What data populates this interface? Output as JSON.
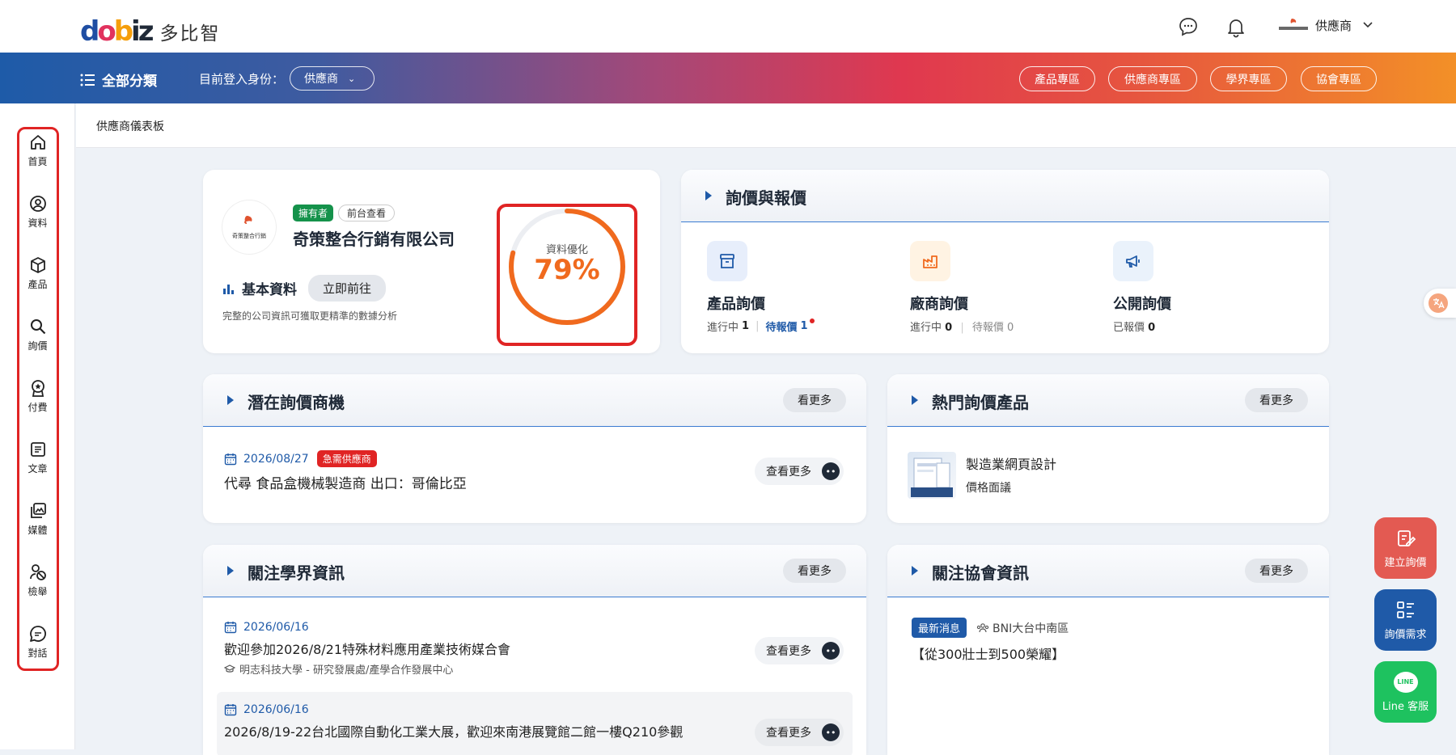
{
  "brand": {
    "logo": "dobiz",
    "name": "多比智",
    "accent": "#1f5aa8",
    "alert": "#e02424",
    "orange": "#f06a1e"
  },
  "top": {
    "chat_icon": "chat-bubble-icon",
    "bell_icon": "bell-icon",
    "user_role": "供應商"
  },
  "band": {
    "all_categories": "全部分類",
    "login_as": "目前登入身份：",
    "role": "供應商",
    "pills": [
      "產品專區",
      "供應商專區",
      "學界專區",
      "協會專區"
    ]
  },
  "sidebar": [
    {
      "label": "首頁",
      "icon": "home-icon"
    },
    {
      "label": "資料",
      "icon": "user-circle-icon"
    },
    {
      "label": "產品",
      "icon": "box-icon"
    },
    {
      "label": "詢價",
      "icon": "search-icon"
    },
    {
      "label": "付費",
      "icon": "award-icon"
    },
    {
      "label": "文章",
      "icon": "document-icon"
    },
    {
      "label": "媒體",
      "icon": "media-icon"
    },
    {
      "label": "檢舉",
      "icon": "report-icon"
    },
    {
      "label": "對話",
      "icon": "chat-icon"
    }
  ],
  "breadcrumb": "供應商儀表板",
  "company": {
    "badge_owner": "擁有者",
    "badge_front": "前台查看",
    "name": "奇策整合行銷有限公司",
    "basic_label": "基本資料",
    "go_label": "立即前往",
    "hint": "完整的公司資訊可獲取更精準的數據分析",
    "logo_text": "奇策整合行銷",
    "optimize_label": "資料優化",
    "optimize_percent": "79%",
    "optimize_value": 0.79
  },
  "quote": {
    "title": "詢價與報價",
    "items": [
      {
        "title": "產品詢價",
        "s1": "進行中",
        "v1": "1",
        "s2": "待報價",
        "v2": "1",
        "icon": "archive-icon"
      },
      {
        "title": "廠商詢價",
        "s1": "進行中",
        "v1": "0",
        "s2": "待報價",
        "v2": "0",
        "icon": "factory-icon"
      },
      {
        "title": "公開詢價",
        "s1": "已報價",
        "v1": "0",
        "icon": "megaphone-icon"
      }
    ]
  },
  "potential": {
    "title": "潛在詢價商機",
    "more": "看更多",
    "date": "2026/08/27",
    "badge": "急需供應商",
    "text": "代尋 食品盒機械製造商 出口：哥倫比亞",
    "view": "查看更多"
  },
  "hot": {
    "title": "熱門詢價產品",
    "more": "看更多",
    "name": "製造業網頁設計",
    "price": "價格面議"
  },
  "academic": {
    "title": "關注學界資訊",
    "more": "看更多",
    "items": [
      {
        "date": "2026/06/16",
        "text": "歡迎參加2026/8/21特殊材料應用產業技術媒合會",
        "org": "明志科技大學 - 研究發展處/產學合作發展中心",
        "view": "查看更多"
      },
      {
        "date": "2026/06/16",
        "text": "2026/8/19-22台北國際自動化工業大展，歡迎來南港展覽館二館一樓Q210參觀",
        "view": "查看更多"
      }
    ]
  },
  "assoc": {
    "title": "關注協會資訊",
    "more": "看更多",
    "badge": "最新消息",
    "org": "BNI大台中南區",
    "text": "【從300壯士到500榮耀】"
  },
  "fabs": {
    "create": "建立詢價",
    "needs": "詢價需求",
    "line": "Line 客服",
    "line_logo": "LINE"
  }
}
